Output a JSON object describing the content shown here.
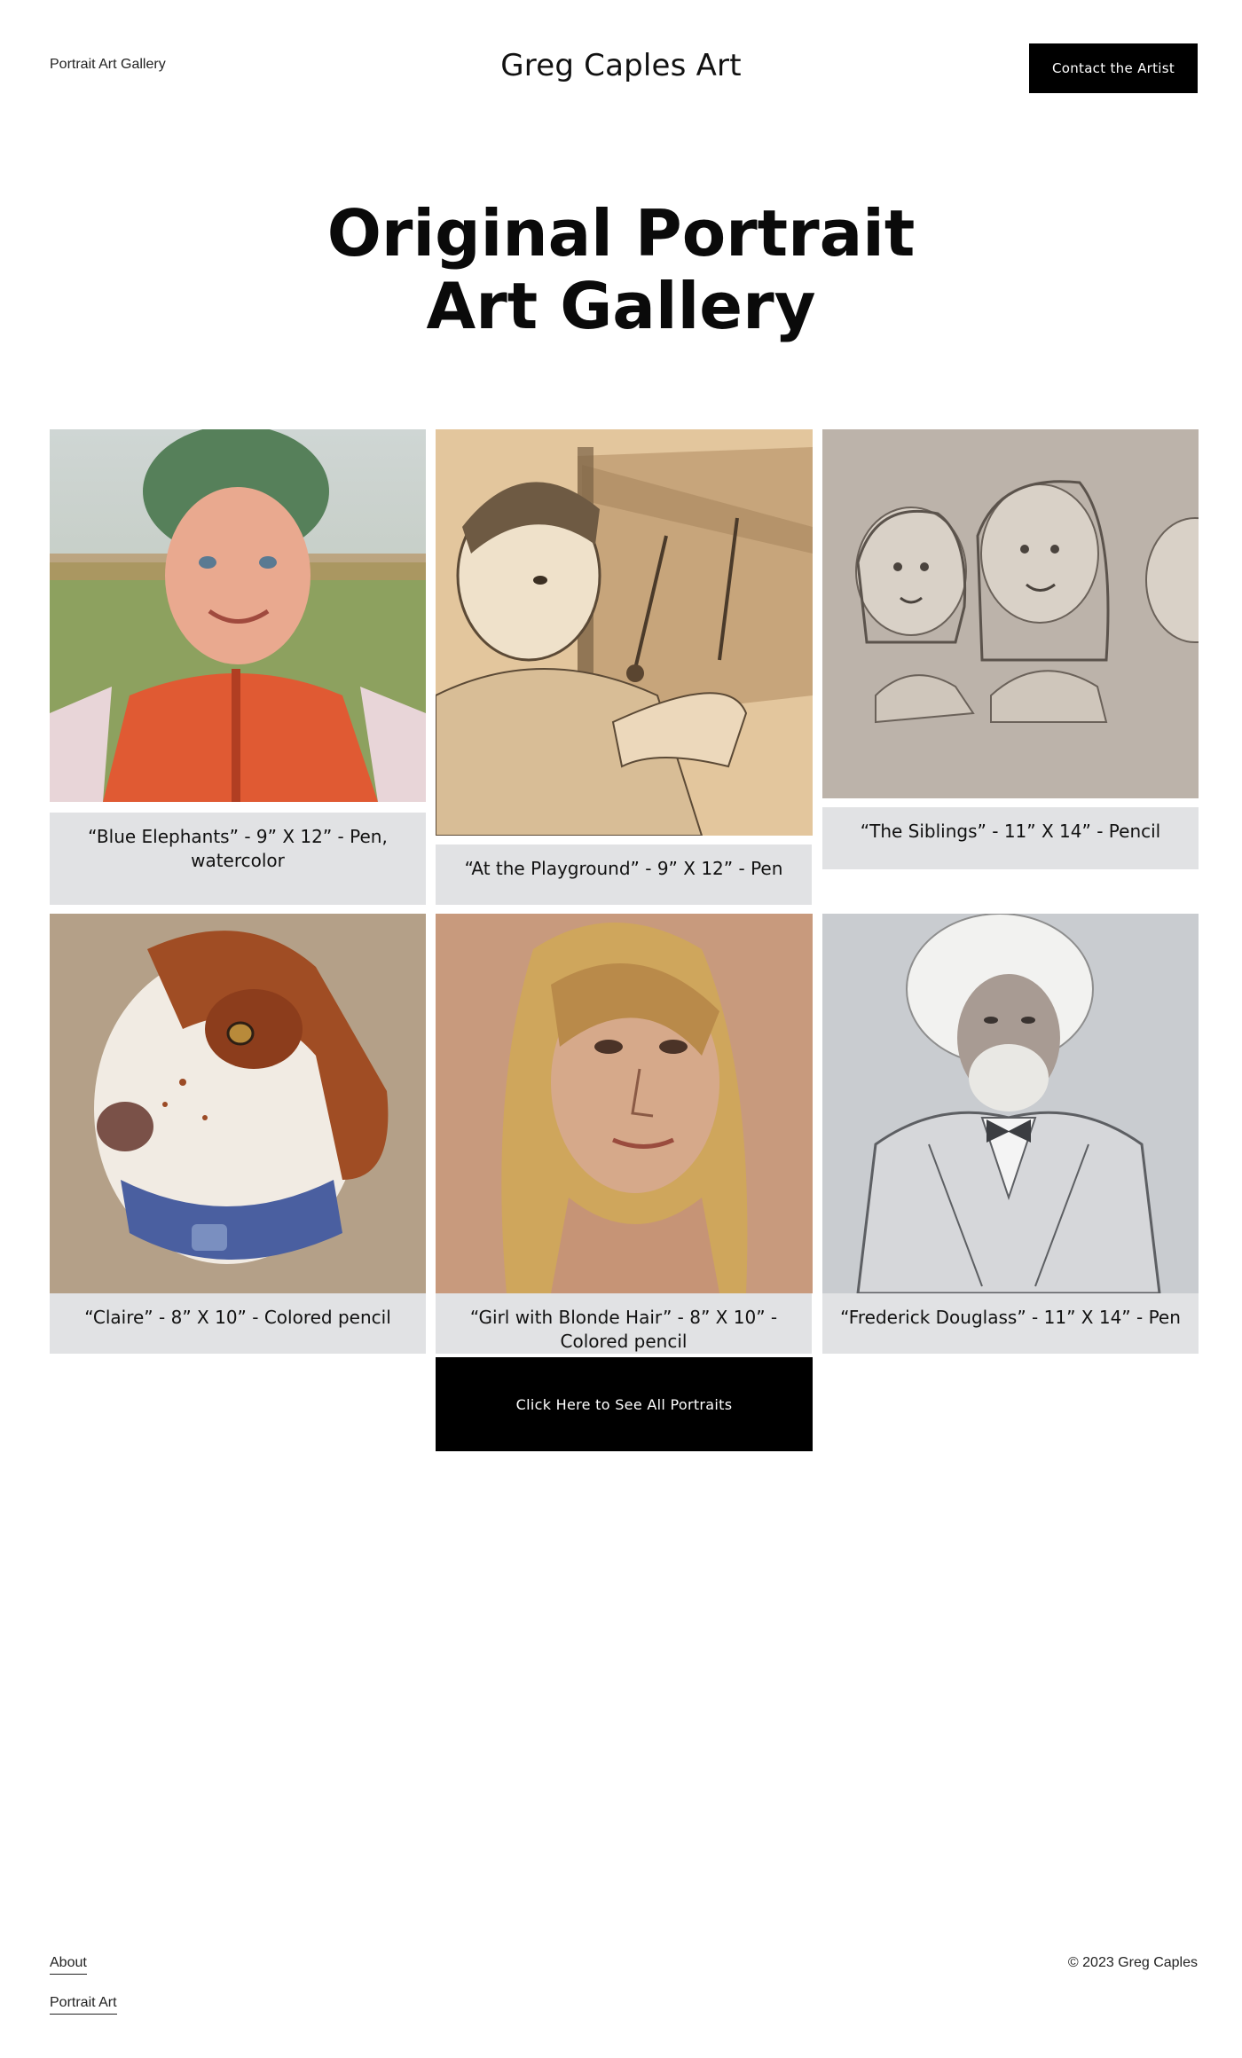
{
  "header": {
    "nav_link": "Portrait Art Gallery",
    "site_title": "Greg Caples Art",
    "cta_label": "Contact the Artist"
  },
  "hero": {
    "line1": "Original Portrait",
    "line2": "Art Gallery"
  },
  "gallery": [
    {
      "caption": "“Blue Elephants” - 9” X 12” - Pen, watercolor"
    },
    {
      "caption": "“At the Playground” - 9” X 12” - Pen"
    },
    {
      "caption": "“The Siblings” - 11” X 14” - Pencil"
    },
    {
      "caption": "“Claire” - 8” X 10” - Colored pencil"
    },
    {
      "caption": "“Girl with Blonde Hair” - 8” X 10” - Colored pencil"
    },
    {
      "caption": "“Frederick Douglass” - 11” X 14” - Pen"
    }
  ],
  "see_all_label": "Click Here to See All Portraits",
  "footer": {
    "links": [
      "About",
      "Portrait Art"
    ],
    "copyright": "© 2023 Greg Caples"
  },
  "colors": {
    "caption_bg": "#e1e2e4",
    "button_bg": "#000000",
    "button_text": "#ffffff"
  }
}
